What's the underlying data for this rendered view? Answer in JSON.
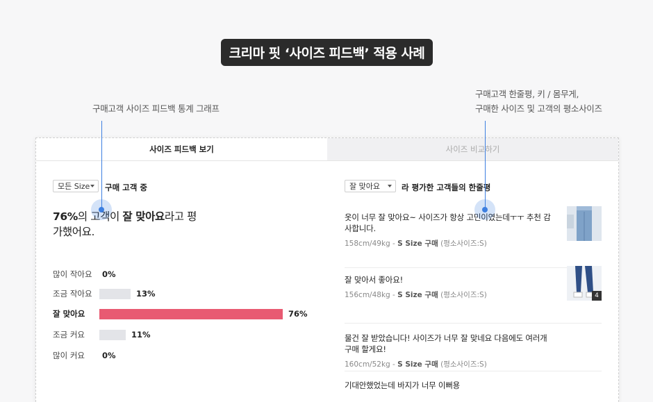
{
  "title": "크리마 핏 ‘사이즈 피드백’ 적용 사례",
  "notes": {
    "left": "구매고객 사이즈 피드백 통계 그래프",
    "right_line1": "구매고객 한줄평, 키 / 몸무게,",
    "right_line2": "구매한 사이즈 및 고객의 평소사이즈"
  },
  "tabs": [
    {
      "label": "사이즈 피드백 보기",
      "active": true
    },
    {
      "label": "사이즈 비교하기",
      "active": false
    }
  ],
  "left": {
    "size_select": "모든 Size",
    "size_suffix": "구매 고객 중",
    "headline_pct": "76%",
    "headline_mid": "의 고객이 ",
    "headline_bold": "잘 맞아요",
    "headline_end": "라고 평가했어요.",
    "bars": [
      {
        "label": "많이 작아요",
        "value": 0,
        "display": "0%",
        "highlight": false
      },
      {
        "label": "조금 작아요",
        "value": 13,
        "display": "13%",
        "highlight": false
      },
      {
        "label": "잘 맞아요",
        "value": 76,
        "display": "76%",
        "highlight": true
      },
      {
        "label": "조금 커요",
        "value": 11,
        "display": "11%",
        "highlight": false
      },
      {
        "label": "많이 커요",
        "value": 0,
        "display": "0%",
        "highlight": false
      }
    ]
  },
  "right": {
    "fit_select": "잘 맞아요",
    "fit_suffix": "라 평가한 고객들의 한줄평",
    "reviews": [
      {
        "text": "옷이 너무 잘 맞아요~ 사이즈가 항상 고민이였는데ㅜㅜ 추천 감사합니다.",
        "body": "158cm/49kg",
        "size": "S Size 구매",
        "usual": "(평소사이즈:S)",
        "has_image": true,
        "image_count": ""
      },
      {
        "text": "잘 맞아서 좋아요!",
        "body": "156cm/48kg",
        "size": "S Size 구매",
        "usual": "(평소사이즈:S)",
        "has_image": true,
        "image_count": "4"
      },
      {
        "text": "물건 잘 받았습니다! 사이즈가 너무 잘 맞네요 다음에도 여러개 구매 할게요!",
        "body": "160cm/52kg",
        "size": "S Size 구매",
        "usual": "(평소사이즈:S)",
        "has_image": false,
        "image_count": ""
      },
      {
        "text": "기대안했었는데 바지가 너무 이뻐용",
        "body": "",
        "size": "",
        "usual": "",
        "has_image": false,
        "image_count": ""
      }
    ]
  },
  "colors": {
    "accent": "#3d7fe0",
    "bar_highlight": "#e85a72",
    "bar_default": "#e3e4e8",
    "pill": "#2b2b2b"
  }
}
